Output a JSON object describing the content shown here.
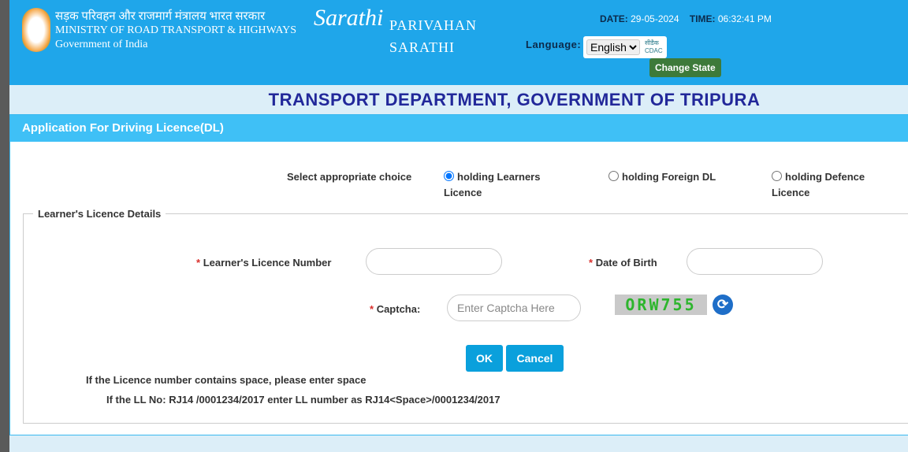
{
  "header": {
    "ministry_hindi": "सड़क परिवहन और राजमार्ग मंत्रालय भारत सरकार",
    "ministry_english": "MINISTRY OF ROAD TRANSPORT & HIGHWAYS",
    "government": "Government of India",
    "logo_text": "Sarathi",
    "parivahan": "PARIVAHAN",
    "sarathi": "SARATHI",
    "date_label": "DATE:",
    "date_value": "29-05-2024",
    "time_label": "TIME:",
    "time_value": "06:32:41 PM",
    "language_label": "Language:",
    "language_selected": "English",
    "cdac_logo": "सीडैक CDAC",
    "change_state": "Change State"
  },
  "department_title": "TRANSPORT DEPARTMENT, GOVERNMENT OF TRIPURA",
  "form": {
    "title": "Application For Driving Licence(DL)",
    "choice_label": "Select appropriate choice",
    "options": [
      {
        "label": "holding Learners",
        "label2": "Licence",
        "checked": true
      },
      {
        "label": "holding Foreign DL",
        "checked": false
      },
      {
        "label": "holding Defence",
        "label2": "Licence",
        "checked": false
      }
    ],
    "fieldset_legend": "Learner's Licence Details",
    "required_mark": "*",
    "ll_number_label": "Learner's Licence Number",
    "ll_number_value": "",
    "dob_label": "Date of Birth",
    "dob_value": "",
    "captcha_label": "Captcha:",
    "captcha_placeholder": "Enter Captcha Here",
    "captcha_image_text": "ORW755",
    "ok": "OK",
    "cancel": "Cancel",
    "note1": "If the Licence number contains space, please enter space",
    "note2": "If the LL No: RJ14 /0001234/2017 enter LL number as RJ14<Space>/0001234/2017"
  },
  "colors": {
    "header": "#1fa6ea",
    "panel_header": "#3fc0f6",
    "button": "#0aa0dc",
    "change_state": "#3d7a3a",
    "title": "#22289a"
  }
}
